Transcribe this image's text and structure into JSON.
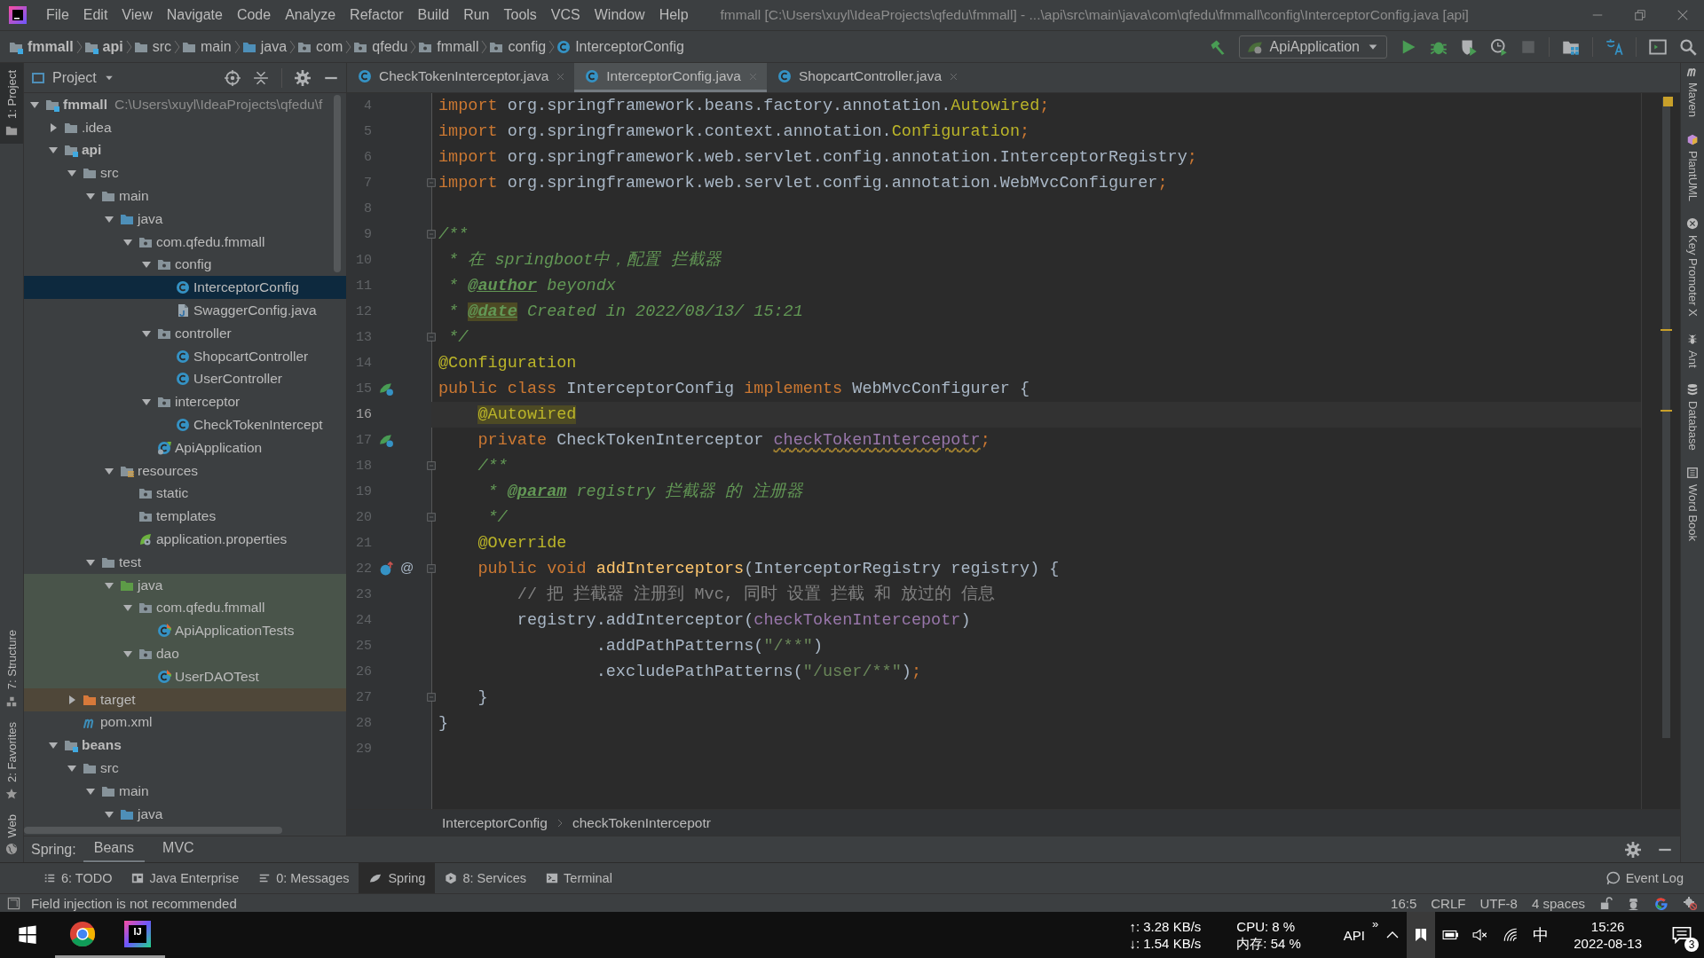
{
  "menu_bar": {
    "items": [
      "File",
      "Edit",
      "View",
      "Navigate",
      "Code",
      "Analyze",
      "Refactor",
      "Build",
      "Run",
      "Tools",
      "VCS",
      "Window",
      "Help"
    ],
    "title": "fmmall [C:\\Users\\xuyl\\IdeaProjects\\qfedu\\fmmall] - ...\\api\\src\\main\\java\\com\\qfedu\\fmmall\\config\\InterceptorConfig.java [api]"
  },
  "navigation_bar": {
    "breadcrumbs": [
      {
        "label": "fmmall",
        "kind": "module"
      },
      {
        "label": "api",
        "kind": "module"
      },
      {
        "label": "src",
        "kind": "folder"
      },
      {
        "label": "main",
        "kind": "folder"
      },
      {
        "label": "java",
        "kind": "source"
      },
      {
        "label": "com",
        "kind": "package"
      },
      {
        "label": "qfedu",
        "kind": "package"
      },
      {
        "label": "fmmall",
        "kind": "package"
      },
      {
        "label": "config",
        "kind": "package"
      },
      {
        "label": "InterceptorConfig",
        "kind": "class"
      }
    ],
    "run_configuration": "ApiApplication"
  },
  "left_stripe": [
    {
      "label": "1: Project",
      "selected": true
    },
    {
      "label": "7: Structure",
      "selected": false
    },
    {
      "label": "2: Favorites",
      "selected": false
    },
    {
      "label": "Web",
      "selected": false
    }
  ],
  "project_panel": {
    "title": "Project",
    "tree": [
      {
        "label": "fmmall",
        "kind": "module",
        "path": "C:\\Users\\xuyl\\IdeaProjects\\qfedu\\f",
        "expanded": true,
        "selected": false,
        "children": [
          {
            "label": ".idea",
            "kind": "folder",
            "expanded": false,
            "selected": false
          },
          {
            "label": "api",
            "kind": "module",
            "expanded": true,
            "selected": false,
            "children": [
              {
                "label": "src",
                "kind": "folder",
                "expanded": true,
                "selected": false,
                "children": [
                  {
                    "label": "main",
                    "kind": "folder",
                    "expanded": true,
                    "selected": false,
                    "children": [
                      {
                        "label": "java",
                        "kind": "source",
                        "expanded": true,
                        "selected": false,
                        "children": [
                          {
                            "label": "com.qfedu.fmmall",
                            "kind": "package",
                            "expanded": true,
                            "selected": false,
                            "children": [
                              {
                                "label": "config",
                                "kind": "package",
                                "expanded": true,
                                "selected": false,
                                "children": [
                                  {
                                    "label": "InterceptorConfig",
                                    "kind": "class",
                                    "selected": true
                                  },
                                  {
                                    "label": "SwaggerConfig.java",
                                    "kind": "java-file",
                                    "selected": false
                                  }
                                ]
                              },
                              {
                                "label": "controller",
                                "kind": "package",
                                "expanded": true,
                                "selected": false,
                                "children": [
                                  {
                                    "label": "ShopcartController",
                                    "kind": "class",
                                    "selected": false
                                  },
                                  {
                                    "label": "UserController",
                                    "kind": "class",
                                    "selected": false
                                  }
                                ]
                              },
                              {
                                "label": "interceptor",
                                "kind": "package",
                                "expanded": true,
                                "selected": false,
                                "children": [
                                  {
                                    "label": "CheckTokenIntercept",
                                    "kind": "class",
                                    "selected": false
                                  }
                                ]
                              },
                              {
                                "label": "ApiApplication",
                                "kind": "spring-class",
                                "selected": false
                              }
                            ]
                          }
                        ]
                      },
                      {
                        "label": "resources",
                        "kind": "resources",
                        "expanded": true,
                        "selected": false,
                        "children": [
                          {
                            "label": "static",
                            "kind": "package",
                            "selected": false
                          },
                          {
                            "label": "templates",
                            "kind": "package",
                            "selected": false
                          },
                          {
                            "label": "application.properties",
                            "kind": "properties",
                            "selected": false
                          }
                        ]
                      }
                    ]
                  },
                  {
                    "label": "test",
                    "kind": "folder",
                    "expanded": true,
                    "selected": false,
                    "children": [
                      {
                        "label": "java",
                        "kind": "test-source",
                        "color": "#49544a",
                        "expanded": true,
                        "selected": false,
                        "children": [
                          {
                            "label": "com.qfedu.fmmall",
                            "kind": "package",
                            "color": "#49544a",
                            "expanded": true,
                            "selected": false,
                            "children": [
                              {
                                "label": "ApiApplicationTests",
                                "kind": "test-class",
                                "color": "#49544a",
                                "selected": false
                              }
                            ]
                          },
                          {
                            "label": "dao",
                            "kind": "package",
                            "color": "#49544a",
                            "expanded": true,
                            "selected": false,
                            "children": [
                              {
                                "label": "UserDAOTest",
                                "kind": "test-class",
                                "color": "#49544a",
                                "selected": false
                              }
                            ]
                          }
                        ]
                      }
                    ]
                  }
                ]
              },
              {
                "label": "target",
                "kind": "excluded",
                "color": "#4f4739",
                "expanded": false,
                "selected": false
              },
              {
                "label": "pom.xml",
                "kind": "maven",
                "selected": false
              }
            ]
          },
          {
            "label": "beans",
            "kind": "module",
            "expanded": true,
            "selected": false,
            "children": [
              {
                "label": "src",
                "kind": "folder",
                "expanded": true,
                "selected": false,
                "children": [
                  {
                    "label": "main",
                    "kind": "folder",
                    "expanded": true,
                    "selected": false,
                    "children": [
                      {
                        "label": "java",
                        "kind": "source",
                        "expanded": true,
                        "selected": false
                      }
                    ]
                  }
                ]
              }
            ]
          }
        ]
      }
    ]
  },
  "editor": {
    "tabs": [
      {
        "label": "CheckTokenInterceptor.java",
        "selected": false
      },
      {
        "label": "InterceptorConfig.java",
        "selected": true
      },
      {
        "label": "ShopcartController.java",
        "selected": false
      }
    ],
    "lines": [
      {
        "number": "4",
        "current": false,
        "fold": false,
        "tokens": [
          {
            "kind": "kw",
            "text": "import "
          },
          {
            "kind": "plain",
            "text": "org.springframework.beans.factory.annotation."
          },
          {
            "kind": "ann",
            "text": "Autowired"
          },
          {
            "kind": "kw",
            "text": ";"
          }
        ]
      },
      {
        "number": "5",
        "current": false,
        "fold": false,
        "tokens": [
          {
            "kind": "kw",
            "text": "import "
          },
          {
            "kind": "plain",
            "text": "org.springframework.context.annotation."
          },
          {
            "kind": "ann",
            "text": "Configuration"
          },
          {
            "kind": "kw",
            "text": ";"
          }
        ]
      },
      {
        "number": "6",
        "current": false,
        "fold": false,
        "tokens": [
          {
            "kind": "kw",
            "text": "import "
          },
          {
            "kind": "plain",
            "text": "org.springframework.web.servlet.config.annotation.InterceptorRegistry"
          },
          {
            "kind": "kw",
            "text": ";"
          }
        ]
      },
      {
        "number": "7",
        "current": false,
        "fold": true,
        "tokens": [
          {
            "kind": "kw",
            "text": "import "
          },
          {
            "kind": "plain",
            "text": "org.springframework.web.servlet.config.annotation.WebMvcConfigurer"
          },
          {
            "kind": "kw",
            "text": ";"
          }
        ]
      },
      {
        "number": "8",
        "current": false,
        "fold": false
      },
      {
        "number": "9",
        "current": false,
        "fold": true,
        "tokens": [
          {
            "kind": "doc",
            "text": "/**"
          }
        ]
      },
      {
        "number": "10",
        "current": false,
        "fold": false,
        "tokens": [
          {
            "kind": "doc",
            "text": " * 在 springboot中，配置 拦截器"
          }
        ]
      },
      {
        "number": "11",
        "current": false,
        "fold": false,
        "tokens": [
          {
            "kind": "doc",
            "text": " * "
          },
          {
            "kind": "doctag",
            "text": "@author"
          },
          {
            "kind": "doc",
            "text": " beyondx"
          }
        ]
      },
      {
        "number": "12",
        "current": false,
        "fold": false,
        "tokens": [
          {
            "kind": "doc",
            "text": " * "
          },
          {
            "kind": "doctag-hl",
            "text": "@date"
          },
          {
            "kind": "doc",
            "text": " Created in 2022/08/13/ 15:21"
          }
        ]
      },
      {
        "number": "13",
        "current": false,
        "fold": true,
        "tokens": [
          {
            "kind": "doc",
            "text": " */"
          }
        ]
      },
      {
        "number": "14",
        "current": false,
        "fold": false,
        "tokens": [
          {
            "kind": "ann",
            "text": "@Configuration"
          }
        ]
      },
      {
        "number": "15",
        "current": false,
        "fold": false,
        "gutter_icon": {
          "kind": "bean"
        },
        "tokens": [
          {
            "kind": "kw",
            "text": "public class "
          },
          {
            "kind": "plain",
            "text": "InterceptorConfig "
          },
          {
            "kind": "kw",
            "text": "implements "
          },
          {
            "kind": "plain",
            "text": "WebMvcConfigurer {"
          }
        ]
      },
      {
        "number": "16",
        "current": true,
        "fold": false,
        "tokens": [
          {
            "kind": "ann-hl",
            "text": "    @Autowired"
          }
        ]
      },
      {
        "number": "17",
        "current": false,
        "fold": false,
        "gutter_icon": {
          "kind": "bean"
        },
        "tokens": [
          {
            "kind": "kw",
            "text": "    private "
          },
          {
            "kind": "plain",
            "text": "CheckTokenInterceptor "
          },
          {
            "kind": "field-warn",
            "text": "checkTokenIntercepotr"
          },
          {
            "kind": "kw",
            "text": ";"
          }
        ]
      },
      {
        "number": "18",
        "current": false,
        "fold": true,
        "tokens": [
          {
            "kind": "doc",
            "text": "    /**"
          }
        ]
      },
      {
        "number": "19",
        "current": false,
        "fold": false,
        "tokens": [
          {
            "kind": "doc",
            "text": "     * "
          },
          {
            "kind": "doctag",
            "text": "@param"
          },
          {
            "kind": "doc",
            "text": " registry 拦截器 的 注册器"
          }
        ]
      },
      {
        "number": "20",
        "current": false,
        "fold": true,
        "tokens": [
          {
            "kind": "doc",
            "text": "     */"
          }
        ]
      },
      {
        "number": "21",
        "current": false,
        "fold": false,
        "tokens": [
          {
            "kind": "ann",
            "text": "    @Override"
          }
        ]
      },
      {
        "number": "22",
        "current": false,
        "fold": true,
        "gutter_icon": {
          "kind": "override"
        },
        "gutter_text": "@",
        "tokens": [
          {
            "kind": "kw",
            "text": "    public void "
          },
          {
            "kind": "method",
            "text": "addInterceptors"
          },
          {
            "kind": "plain",
            "text": "(InterceptorRegistry registry) {"
          }
        ]
      },
      {
        "number": "23",
        "current": false,
        "fold": false,
        "tokens": [
          {
            "kind": "comment",
            "text": "        // 把 拦截器 注册到 Mvc, 同时 设置 拦截 和 放过的 信息"
          }
        ]
      },
      {
        "number": "24",
        "current": false,
        "fold": false,
        "tokens": [
          {
            "kind": "plain",
            "text": "        registry.addInterceptor("
          },
          {
            "kind": "field",
            "text": "checkTokenIntercepotr"
          },
          {
            "kind": "plain",
            "text": ")"
          }
        ]
      },
      {
        "number": "25",
        "current": false,
        "fold": false,
        "tokens": [
          {
            "kind": "plain",
            "text": "                .addPathPatterns("
          },
          {
            "kind": "string",
            "text": "\"/**\""
          },
          {
            "kind": "plain",
            "text": ")"
          }
        ]
      },
      {
        "number": "26",
        "current": false,
        "fold": false,
        "tokens": [
          {
            "kind": "plain",
            "text": "                .excludePathPatterns("
          },
          {
            "kind": "string",
            "text": "\"/user/**\""
          },
          {
            "kind": "plain",
            "text": ")"
          },
          {
            "kind": "kw",
            "text": ";"
          }
        ]
      },
      {
        "number": "27",
        "current": false,
        "fold": true,
        "tokens": [
          {
            "kind": "plain",
            "text": "    }"
          }
        ]
      },
      {
        "number": "28",
        "current": false,
        "fold": false,
        "tokens": [
          {
            "kind": "plain",
            "text": "}"
          }
        ]
      },
      {
        "number": "29",
        "current": false,
        "fold": false
      }
    ],
    "breadcrumbs": [
      "InterceptorConfig",
      "checkTokenIntercepotr"
    ]
  },
  "right_stripe": [
    {
      "label": "Maven",
      "kind": "maven"
    },
    {
      "label": "PlantUML",
      "kind": "plantuml"
    },
    {
      "label": "Key Promoter X",
      "kind": "keypromoter"
    },
    {
      "label": "Ant",
      "kind": "ant"
    },
    {
      "label": "Database",
      "kind": "database"
    },
    {
      "label": "Word Book",
      "kind": "book"
    }
  ],
  "spring_panel": {
    "label": "Spring:",
    "tabs": [
      {
        "label": "Beans",
        "selected": true
      },
      {
        "label": "MVC",
        "selected": false
      }
    ]
  },
  "tool_windows": [
    {
      "label": "6: TODO",
      "kind": "todo",
      "selected": false
    },
    {
      "label": "Java Enterprise",
      "kind": "enterprise",
      "selected": false
    },
    {
      "label": "0: Messages",
      "kind": "messages",
      "selected": false
    },
    {
      "label": "Spring",
      "kind": "spring",
      "selected": true
    },
    {
      "label": "8: Services",
      "kind": "services",
      "selected": false
    },
    {
      "label": "Terminal",
      "kind": "terminal",
      "selected": false
    }
  ],
  "event_log": "Event Log",
  "status_bar": {
    "message": "Field injection is not recommended",
    "items": [
      "16:5",
      "CRLF",
      "UTF-8",
      "4 spaces"
    ]
  },
  "taskbar": {
    "apps": [
      {
        "kind": "windows",
        "running": false
      },
      {
        "kind": "browser",
        "running": true
      },
      {
        "kind": "ide",
        "label": "IJ",
        "running": true
      }
    ],
    "upload": "↑: 3.28 KB/s",
    "download": "↓: 1.54 KB/s",
    "cpu": "CPU: 8 %",
    "memory": "内存: 54 %",
    "toolbar": "API",
    "toolbar_expand": "»",
    "input_method": "中",
    "time": "15:26",
    "date": "2022-08-13",
    "notifications": "3"
  }
}
